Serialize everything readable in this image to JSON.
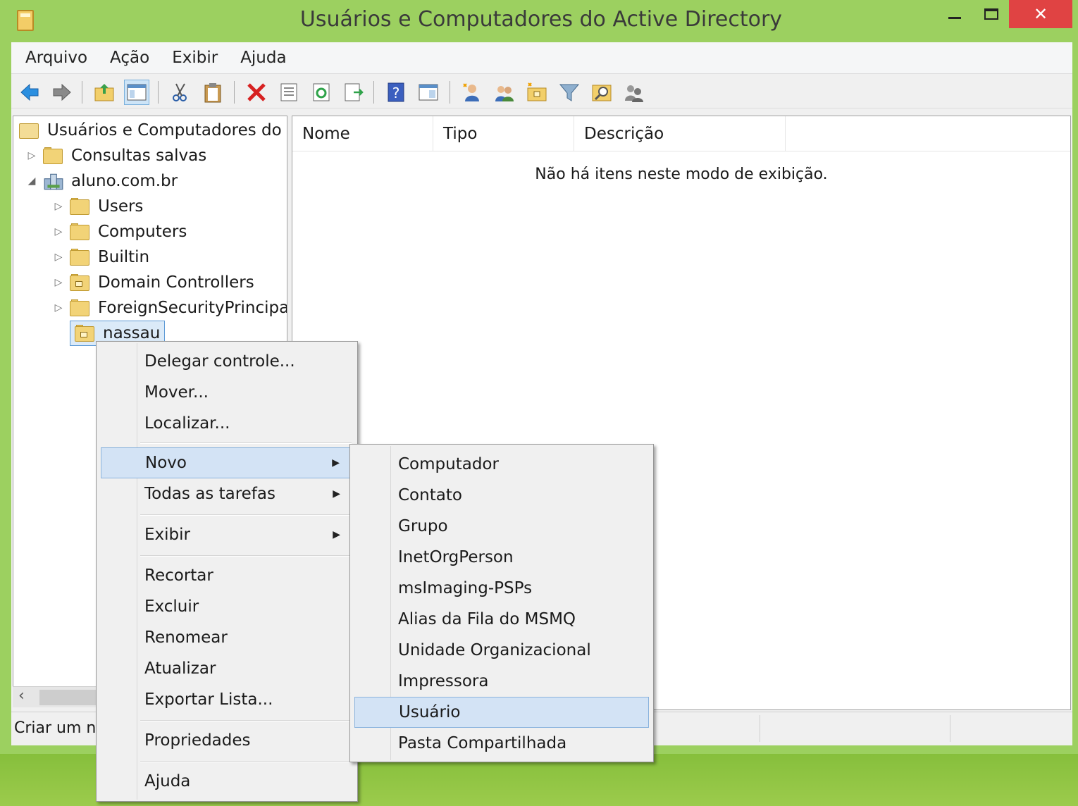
{
  "window": {
    "title": "Usuários e Computadores do Active Directory",
    "close_glyph": "✕"
  },
  "menubar": [
    "Arquivo",
    "Ação",
    "Exibir",
    "Ajuda"
  ],
  "toolbar": {
    "icons": [
      "back-arrow-icon",
      "forward-arrow-icon",
      "up-folder-icon",
      "show-hide-tree-icon",
      "cut-icon",
      "paste-icon",
      "delete-icon",
      "properties-icon",
      "refresh-icon",
      "export-list-icon",
      "help-icon",
      "console-view-icon",
      "new-user-icon",
      "new-group-icon",
      "new-ou-icon",
      "filter-icon",
      "find-icon",
      "add-to-group-icon"
    ]
  },
  "tree": {
    "root": "Usuários e Computadores do Ac",
    "saved_queries": "Consultas salvas",
    "domain": "aluno.com.br",
    "children": [
      "Users",
      "Computers",
      "Builtin",
      "Domain Controllers",
      "ForeignSecurityPrincipals"
    ],
    "selected": "nassau"
  },
  "list": {
    "columns": [
      "Nome",
      "Tipo",
      "Descrição"
    ],
    "empty_message": "Não há itens neste modo de exibição."
  },
  "statusbar": {
    "text": "Criar um ne"
  },
  "context_menu": {
    "items": [
      "Delegar controle...",
      "Mover...",
      "Localizar...",
      "Novo",
      "Todas as tarefas",
      "Exibir",
      "Recortar",
      "Excluir",
      "Renomear",
      "Atualizar",
      "Exportar Lista...",
      "Propriedades",
      "Ajuda"
    ],
    "highlighted": "Novo"
  },
  "submenu_novo": {
    "items": [
      "Computador",
      "Contato",
      "Grupo",
      "InetOrgPerson",
      "msImaging-PSPs",
      "Alias da Fila do MSMQ",
      "Unidade Organizacional",
      "Impressora",
      "Usuário",
      "Pasta Compartilhada"
    ],
    "highlighted": "Usuário"
  },
  "colors": {
    "titlebar": "#9cd060",
    "close_button": "#e04343",
    "highlight": "#d3e3f5",
    "highlight_border": "#8ab3dd"
  }
}
